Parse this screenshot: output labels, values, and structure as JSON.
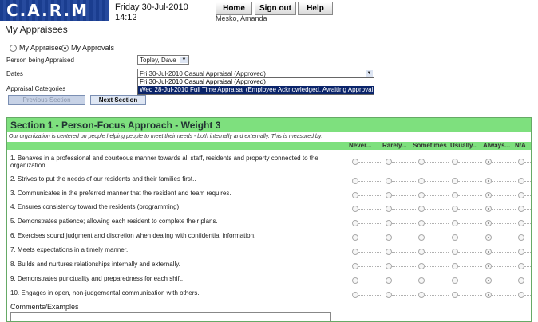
{
  "app": {
    "logo_text": "C.A.R.M"
  },
  "header": {
    "date": "Friday 30-Jul-2010",
    "time": "14:12",
    "buttons": {
      "home": "Home",
      "signout": "Sign out",
      "help": "Help"
    },
    "user": "Mesko, Amanda"
  },
  "page": {
    "title": "My Appraisees",
    "radios": [
      {
        "label": "My Appraisees",
        "checked": false
      },
      {
        "label": "My Approvals",
        "checked": true
      }
    ],
    "fields": {
      "person_label": "Person being Appraised",
      "person_value": "Topley, Dave",
      "dates_label": "Dates",
      "dates_value": "Fri 30-Jul-2010 Casual Appraisal (Approved)",
      "dates_options": [
        {
          "label": "Fri 30-Jul-2010 Casual Appraisal (Approved)",
          "selected": false
        },
        {
          "label": "Wed 28-Jul-2010 Full Time Appraisal (Employee Acknowledged, Awaiting Approval.)",
          "selected": true
        }
      ],
      "categories_label": "Appraisal Categories"
    },
    "nav": {
      "previous": "Previous Section",
      "next": "Next Section"
    }
  },
  "section": {
    "title": "Section 1 - Person-Focus Approach - Weight 3",
    "description": "Our organization is centered on people helping people to meet their needs - both internally and externally. This is measured by:",
    "scale": [
      "Never...",
      "Rarely...",
      "Sometimes",
      "Usually...",
      "Always...",
      "N/A"
    ],
    "questions": [
      {
        "text": "1. Behaves in a professional and courteous manner towards all staff, residents and property connected to the organization.",
        "selected": 4
      },
      {
        "text": "2. Strives to put the needs of our residents and their families first..",
        "selected": 4
      },
      {
        "text": "3. Communicates in the preferred manner that the resident and team requires.",
        "selected": 4
      },
      {
        "text": "4. Ensures consistency toward the residents (programming).",
        "selected": 4
      },
      {
        "text": "5. Demonstrates patience; allowing each resident to complete their plans.",
        "selected": 4
      },
      {
        "text": "6. Exercises sound judgment and discretion when dealing with confidential information.",
        "selected": 4
      },
      {
        "text": "7. Meets expectations in a timely manner.",
        "selected": 4
      },
      {
        "text": "8. Builds and nurtures relationships internally and externally.",
        "selected": 4
      },
      {
        "text": "9. Demonstrates punctuality and preparedness for each shift.",
        "selected": 4
      },
      {
        "text": "10. Engages in open, non-judgemental communication with others.",
        "selected": 4
      }
    ],
    "comments_label": "Comments/Examples"
  }
}
